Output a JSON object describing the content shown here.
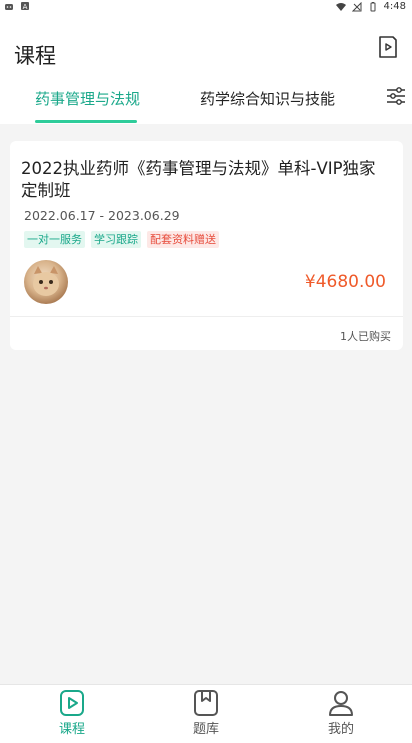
{
  "status_bar": {
    "time": "4:48"
  },
  "header": {
    "title": "课程",
    "play_icon": "video-play-icon"
  },
  "tabs": [
    {
      "label": "药事管理与法规",
      "active": true
    },
    {
      "label": "药学综合知识与技能",
      "active": false
    }
  ],
  "filter_icon": "filter-sliders-icon",
  "course": {
    "title": "2022执业药师《药事管理与法规》单科-VIP独家定制班",
    "dates": "2022.06.17 - 2023.06.29",
    "tags": [
      {
        "label": "一对一服务",
        "color": "#1aa88a"
      },
      {
        "label": "学习跟踪",
        "color": "#1aa88a"
      },
      {
        "label": "配套资料赠送",
        "color": "#e74c3c"
      }
    ],
    "price": "¥4680.00",
    "purchased": "1人已购买"
  },
  "bottom_nav": [
    {
      "label": "课程",
      "icon": "course-play-icon",
      "active": true
    },
    {
      "label": "题库",
      "icon": "question-bank-icon",
      "active": false
    },
    {
      "label": "我的",
      "icon": "profile-icon",
      "active": false
    }
  ],
  "colors": {
    "accent": "#1aa88a",
    "price": "#ef5a2a"
  }
}
